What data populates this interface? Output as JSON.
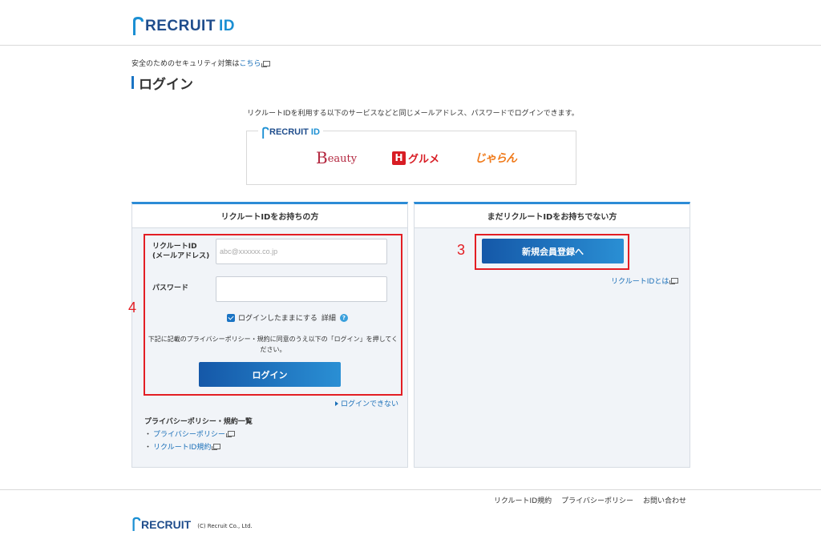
{
  "header": {
    "logo_text": "RECRUIT",
    "logo_id": "ID"
  },
  "security_notice": {
    "text": "安全のためのセキュリティ対策は",
    "link": "こちら"
  },
  "page_title": "ログイン",
  "services": {
    "note": "リクルートIDを利用する以下のサービスなどと同じメールアドレス、パスワードでログインできます。",
    "logo_text": "RECRUIT",
    "logo_id": "ID",
    "beauty_b": "B",
    "beauty_rest": "eauty",
    "gourmet_mark": "H",
    "gourmet_text": "グルメ",
    "jaran_text": "じゃらん"
  },
  "login_panel": {
    "title": "リクルートIDをお持ちの方",
    "id_label_1": "リクルートID",
    "id_label_2": "(メールアドレス)",
    "id_placeholder": "abc@xxxxxx.co.jp",
    "pw_label": "パスワード",
    "pw_value": "",
    "remember_label": "ログインしたままにする",
    "remember_detail": "詳細",
    "help_glyph": "?",
    "remember_checked": true,
    "agree_text": "下記に記載のプライバシーポリシー・規約に同意のうえ以下の「ログイン」を押してください。",
    "login_button": "ログイン",
    "cant_login": "ログインできない",
    "policy_title": "プライバシーポリシー・規約一覧",
    "policy_links": [
      "プライバシーポリシー",
      "リクルートID規約"
    ],
    "bullet": "・"
  },
  "register_panel": {
    "title": "まだリクルートIDをお持ちでない方",
    "register_button": "新規会員登録へ",
    "about_link": "リクルートIDとは"
  },
  "annotations": {
    "step_3": "3",
    "step_4": "4",
    "highlight_color": "#e31e24"
  },
  "footer": {
    "links": [
      "リクルートID規約",
      "プライバシーポリシー",
      "お問い合わせ"
    ],
    "logo_text": "RECRUIT",
    "copyright": "(C) Recruit Co., Ltd."
  },
  "colors": {
    "accent": "#1a74c4",
    "link": "#1a6fb8",
    "panel_bg": "#f1f4f8"
  }
}
